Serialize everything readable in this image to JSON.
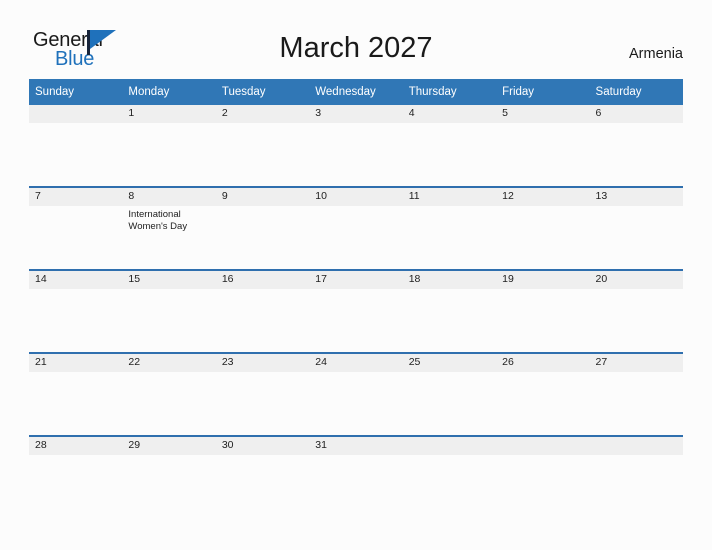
{
  "branding": {
    "logo_text_primary": "General",
    "logo_text_secondary": "Blue",
    "logo_icon": "flag-icon",
    "accent_color": "#1f71bb"
  },
  "header": {
    "title": "March 2027",
    "country": "Armenia"
  },
  "calendar": {
    "header_bg": "#3077b6",
    "band_bg": "#efefef",
    "row_divider": "#2f6fae",
    "weekdays": [
      "Sunday",
      "Monday",
      "Tuesday",
      "Wednesday",
      "Thursday",
      "Friday",
      "Saturday"
    ],
    "weeks": [
      [
        {
          "day": "",
          "events": []
        },
        {
          "day": "1",
          "events": []
        },
        {
          "day": "2",
          "events": []
        },
        {
          "day": "3",
          "events": []
        },
        {
          "day": "4",
          "events": []
        },
        {
          "day": "5",
          "events": []
        },
        {
          "day": "6",
          "events": []
        }
      ],
      [
        {
          "day": "7",
          "events": []
        },
        {
          "day": "8",
          "events": [
            "International",
            "Women's Day"
          ]
        },
        {
          "day": "9",
          "events": []
        },
        {
          "day": "10",
          "events": []
        },
        {
          "day": "11",
          "events": []
        },
        {
          "day": "12",
          "events": []
        },
        {
          "day": "13",
          "events": []
        }
      ],
      [
        {
          "day": "14",
          "events": []
        },
        {
          "day": "15",
          "events": []
        },
        {
          "day": "16",
          "events": []
        },
        {
          "day": "17",
          "events": []
        },
        {
          "day": "18",
          "events": []
        },
        {
          "day": "19",
          "events": []
        },
        {
          "day": "20",
          "events": []
        }
      ],
      [
        {
          "day": "21",
          "events": []
        },
        {
          "day": "22",
          "events": []
        },
        {
          "day": "23",
          "events": []
        },
        {
          "day": "24",
          "events": []
        },
        {
          "day": "25",
          "events": []
        },
        {
          "day": "26",
          "events": []
        },
        {
          "day": "27",
          "events": []
        }
      ],
      [
        {
          "day": "28",
          "events": []
        },
        {
          "day": "29",
          "events": []
        },
        {
          "day": "30",
          "events": []
        },
        {
          "day": "31",
          "events": []
        },
        {
          "day": "",
          "events": []
        },
        {
          "day": "",
          "events": []
        },
        {
          "day": "",
          "events": []
        }
      ]
    ]
  }
}
